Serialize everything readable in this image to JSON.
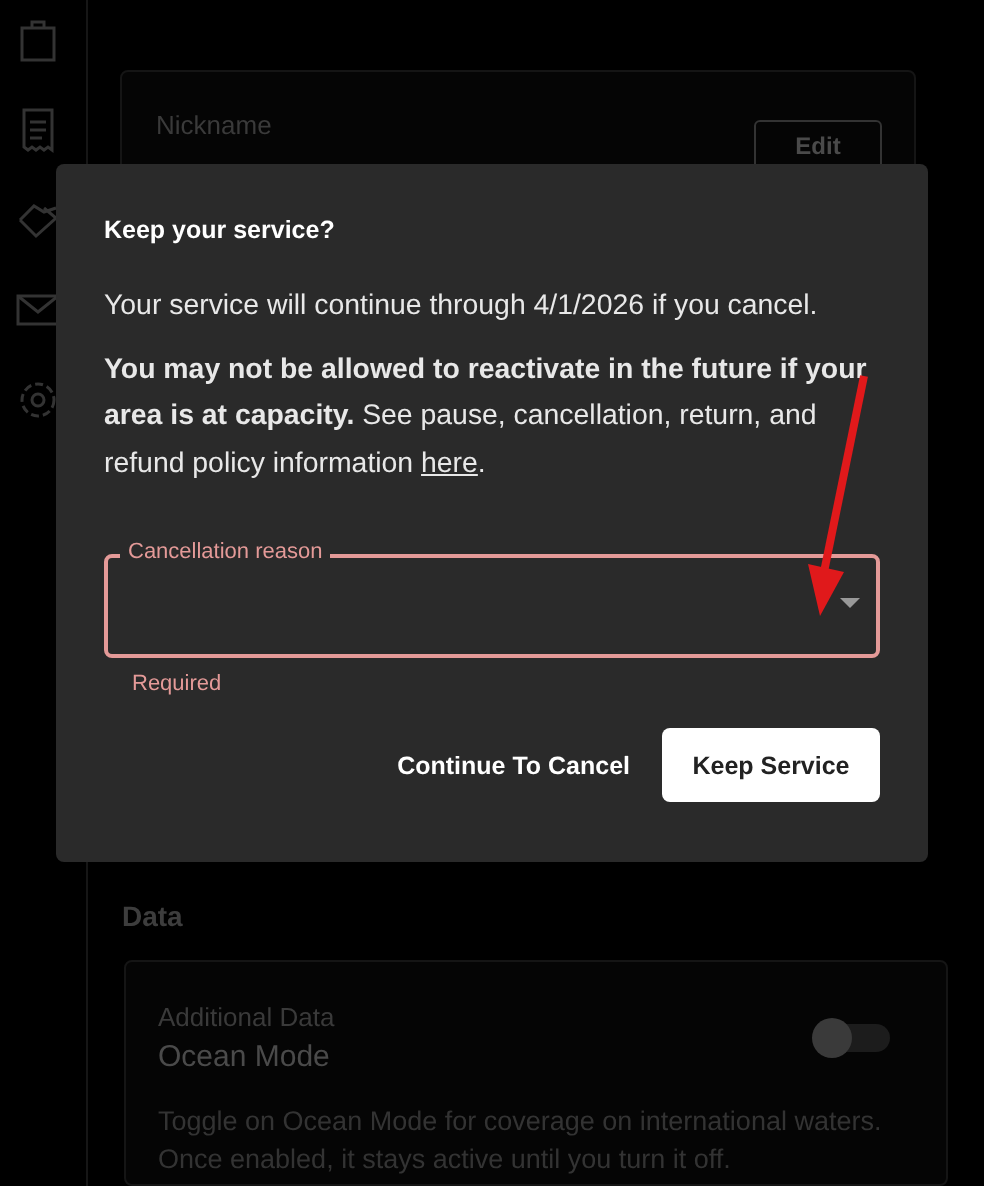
{
  "nickname_card": {
    "label": "Nickname",
    "edit_button": "Edit"
  },
  "data_section": {
    "heading": "Data",
    "card": {
      "label": "Additional Data",
      "title": "Ocean Mode",
      "on": false,
      "description": "Toggle on Ocean Mode for coverage on international waters. Once enabled, it stays active until you turn it off."
    }
  },
  "dialog": {
    "title": "Keep your service?",
    "message": "Your service will continue through 4/1/2026 if you cancel.",
    "notice": "**You may not be allowed to reactivate in the future if your area is at capacity.** See pause, cancellation, return, and refund policy information ",
    "notice_link": "here",
    "notice_end": ".",
    "field": {
      "label": "Cancellation reason",
      "invalid": true,
      "helper": "Required"
    },
    "buttons": [
      {
        "label": "Continue To Cancel",
        "kind": "text"
      },
      {
        "label": "Keep Service",
        "kind": "filled"
      }
    ]
  }
}
